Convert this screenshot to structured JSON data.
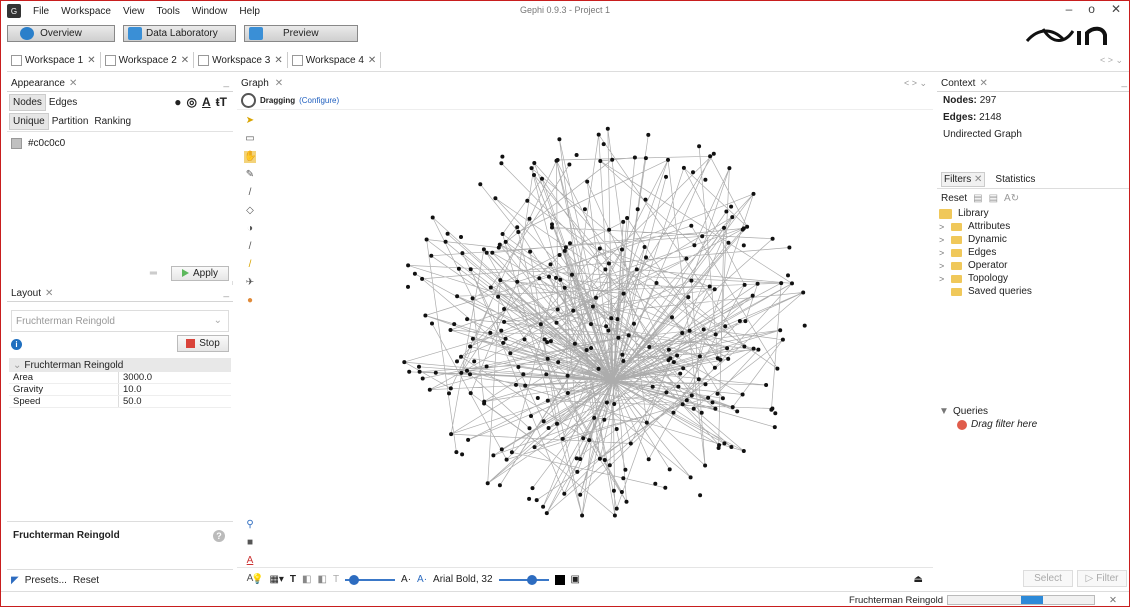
{
  "window": {
    "title": "Gephi 0.9.3 - Project 1",
    "menu": [
      "File",
      "Workspace",
      "View",
      "Tools",
      "Window",
      "Help"
    ],
    "controls": [
      "–",
      "o",
      "✕"
    ]
  },
  "modes": {
    "overview": "Overview",
    "data_lab": "Data Laboratory",
    "preview": "Preview"
  },
  "workspaces": [
    {
      "label": "Workspace 1"
    },
    {
      "label": "Workspace 2"
    },
    {
      "label": "Workspace 3"
    },
    {
      "label": "Workspace 4"
    }
  ],
  "appearance": {
    "title": "Appearance",
    "tabs": [
      "Nodes",
      "Edges"
    ],
    "subtabs": [
      "Unique",
      "Partition",
      "Ranking"
    ],
    "color_value": "#c0c0c0",
    "color_label": "#c0c0c0",
    "apply": "Apply"
  },
  "layout": {
    "title": "Layout",
    "algorithm_placeholder": "Fruchterman Reingold",
    "stop": "Stop",
    "group": "Fruchterman Reingold",
    "props": [
      {
        "k": "Area",
        "v": "3000.0"
      },
      {
        "k": "Gravity",
        "v": "10.0"
      },
      {
        "k": "Speed",
        "v": "50.0"
      }
    ],
    "description_title": "Fruchterman Reingold",
    "presets": "Presets...",
    "reset": "Reset"
  },
  "graph": {
    "title": "Graph",
    "mode": "Dragging",
    "configure": "(Configure)",
    "font": "Arial Bold, 32"
  },
  "context": {
    "title": "Context",
    "nodes_label": "Nodes:",
    "nodes": "297",
    "edges_label": "Edges:",
    "edges": "2148",
    "type": "Undirected Graph"
  },
  "filters": {
    "tabs": [
      "Filters",
      "Statistics"
    ],
    "reset": "Reset",
    "library": "Library",
    "items": [
      "Attributes",
      "Dynamic",
      "Edges",
      "Operator",
      "Topology"
    ],
    "saved": "Saved queries",
    "queries": "Queries",
    "drag_hint": "Drag filter here",
    "select": "Select",
    "filter": "Filter"
  },
  "status": {
    "task": "Fruchterman Reingold",
    "progress": 0.5
  }
}
